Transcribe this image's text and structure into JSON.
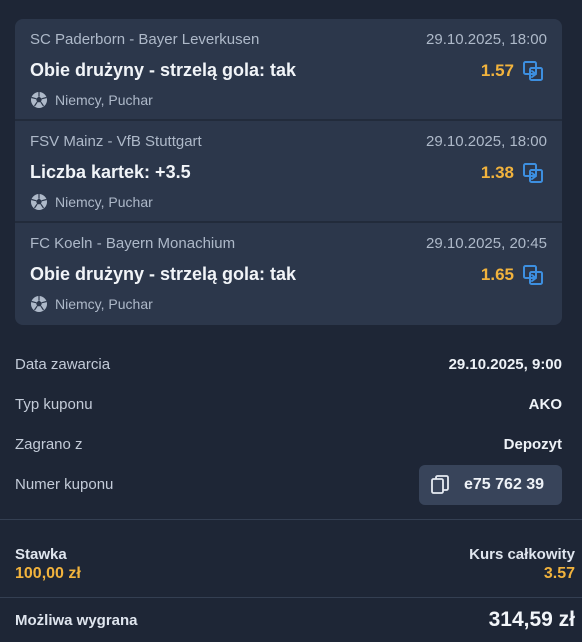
{
  "legs": [
    {
      "match": "SC Paderborn - Bayer Leverkusen",
      "date": "29.10.2025, 18:00",
      "selection": "Obie drużyny - strzelą gola: tak",
      "odds": "1.57",
      "league": "Niemcy, Puchar",
      "icons": {
        "sport": "football-icon",
        "action": "bet-builder-icon"
      }
    },
    {
      "match": "FSV Mainz - VfB Stuttgart",
      "date": "29.10.2025, 18:00",
      "selection": "Liczba kartek: +3.5",
      "odds": "1.38",
      "league": "Niemcy, Puchar",
      "icons": {
        "sport": "football-icon",
        "action": "bet-builder-icon"
      }
    },
    {
      "match": "FC Koeln - Bayern Monachium",
      "date": "29.10.2025, 20:45",
      "selection": "Obie drużyny - strzelą gola: tak",
      "odds": "1.65",
      "league": "Niemcy, Puchar",
      "icons": {
        "sport": "football-icon",
        "action": "bet-builder-icon"
      }
    }
  ],
  "details": {
    "date_label": "Data zawarcia",
    "date_value": "29.10.2025, 9:00",
    "type_label": "Typ kuponu",
    "type_value": "AKO",
    "source_label": "Zagrano z",
    "source_value": "Depozyt",
    "coupon_label": "Numer kuponu",
    "coupon_value": "e75 762 39"
  },
  "summary": {
    "stake_label": "Stawka",
    "stake_value": "100,00 zł",
    "total_odds_label": "Kurs całkowity",
    "total_odds_value": "3.57",
    "win_label": "Możliwa wygrana",
    "win_value": "314,59 zł"
  },
  "colors": {
    "background": "#1e2636",
    "card": "#2c374b",
    "accent_odds": "#f2b33d",
    "icon_blue": "#3d8fe0"
  }
}
